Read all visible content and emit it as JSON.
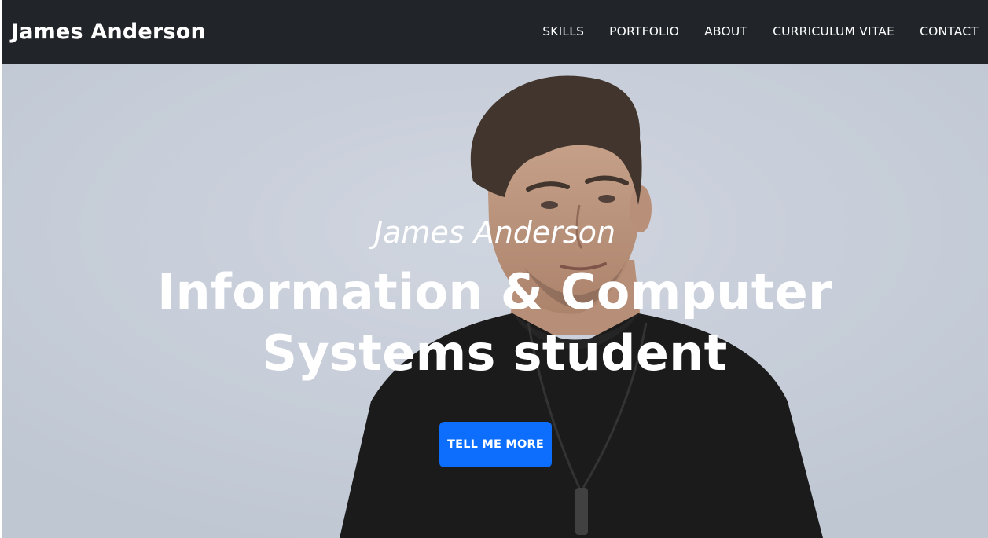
{
  "header": {
    "brand": "James Anderson",
    "nav": [
      {
        "label": "SKILLS"
      },
      {
        "label": "PORTFOLIO"
      },
      {
        "label": "ABOUT"
      },
      {
        "label": "CURRICULUM VITAE"
      },
      {
        "label": "CONTACT"
      }
    ]
  },
  "hero": {
    "subtitle": "James Anderson",
    "title": "Information & Computer Systems student",
    "cta_label": "TELL ME MORE",
    "photo_icon": "portrait-photo"
  },
  "colors": {
    "navbar_bg": "#212529",
    "accent": "#0d6efd",
    "hero_bg": "#c8cfda"
  }
}
